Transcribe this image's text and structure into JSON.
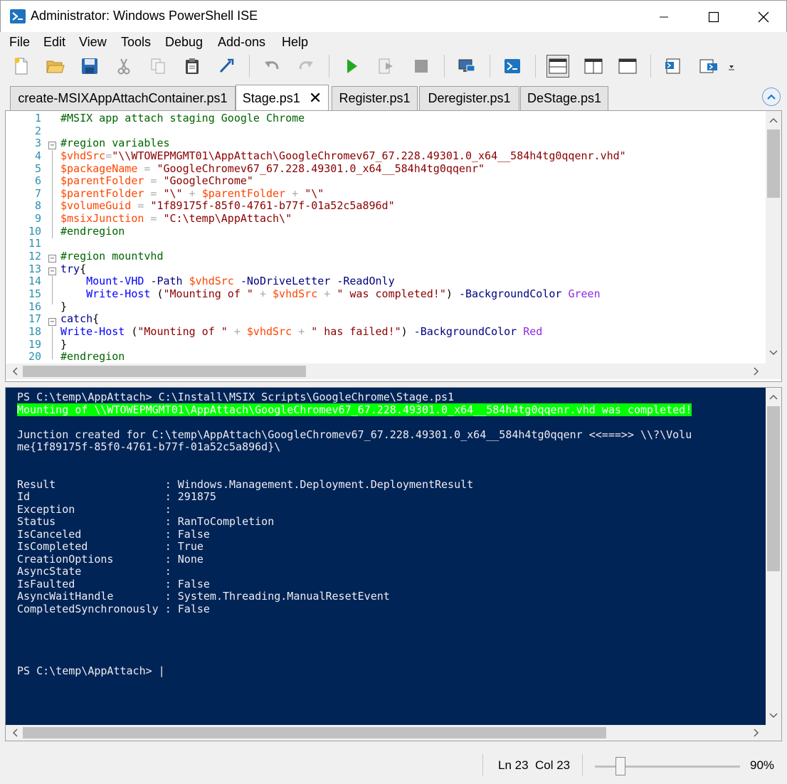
{
  "window": {
    "title": "Administrator: Windows PowerShell ISE",
    "min_glyph": "—",
    "max_glyph": "☐",
    "close_glyph": "✕"
  },
  "menu": [
    "File",
    "Edit",
    "View",
    "Tools",
    "Debug",
    "Add-ons",
    "Help"
  ],
  "toolbar": {
    "buttons": [
      "new-icon",
      "open-icon",
      "save-icon",
      "cut-icon",
      "copy-icon",
      "paste-icon",
      "clear-icon",
      "undo-icon",
      "redo-icon",
      "run-icon",
      "run-selection-icon",
      "stop-icon",
      "remote-icon",
      "powershell-icon",
      "layout-top-icon",
      "layout-right-icon",
      "layout-max-icon",
      "show-script-icon",
      "show-console-icon",
      "overflow-icon"
    ]
  },
  "tabs": [
    {
      "label": "create-MSIXAppAttachContainer.ps1",
      "active": false
    },
    {
      "label": "Stage.ps1",
      "active": true,
      "close": "✕"
    },
    {
      "label": "Register.ps1",
      "active": false
    },
    {
      "label": "Deregister.ps1",
      "active": false
    },
    {
      "label": "DeStage.ps1",
      "active": false
    }
  ],
  "editor": {
    "line_numbers": [
      "1",
      "2",
      "3",
      "4",
      "5",
      "6",
      "7",
      "8",
      "9",
      "10",
      "11",
      "12",
      "13",
      "14",
      "15",
      "16",
      "17",
      "18",
      "19",
      "20"
    ],
    "lines": [
      [
        {
          "t": "#MSIX app attach staging Google Chrome",
          "c": "comment"
        }
      ],
      [],
      [
        {
          "t": "#region variables",
          "c": "comment"
        }
      ],
      [
        {
          "t": "$vhdSrc",
          "c": "var"
        },
        {
          "t": "=",
          "c": "op"
        },
        {
          "t": "\"\\\\WTOWEPMGMT01\\AppAttach\\GoogleChromev67_67.228.49301.0_x64__584h4tg0qqenr.vhd\"",
          "c": "str"
        }
      ],
      [
        {
          "t": "$packageName",
          "c": "var"
        },
        {
          "t": " = ",
          "c": "op"
        },
        {
          "t": "\"GoogleChromev67_67.228.49301.0_x64__584h4tg0qqenr\"",
          "c": "str"
        }
      ],
      [
        {
          "t": "$parentFolder",
          "c": "var"
        },
        {
          "t": " = ",
          "c": "op"
        },
        {
          "t": "\"GoogleChrome\"",
          "c": "str"
        }
      ],
      [
        {
          "t": "$parentFolder",
          "c": "var"
        },
        {
          "t": " = ",
          "c": "op"
        },
        {
          "t": "\"\\\"",
          "c": "str"
        },
        {
          "t": " + ",
          "c": "op"
        },
        {
          "t": "$parentFolder",
          "c": "var"
        },
        {
          "t": " + ",
          "c": "op"
        },
        {
          "t": "\"\\\"",
          "c": "str"
        }
      ],
      [
        {
          "t": "$volumeGuid",
          "c": "var"
        },
        {
          "t": " = ",
          "c": "op"
        },
        {
          "t": "\"1f89175f-85f0-4761-b77f-01a52c5a896d\"",
          "c": "str"
        }
      ],
      [
        {
          "t": "$msixJunction",
          "c": "var"
        },
        {
          "t": " = ",
          "c": "op"
        },
        {
          "t": "\"C:\\temp\\AppAttach\\\"",
          "c": "str"
        }
      ],
      [
        {
          "t": "#endregion",
          "c": "comment"
        }
      ],
      [],
      [
        {
          "t": "#region mountvhd",
          "c": "comment"
        }
      ],
      [
        {
          "t": "try",
          "c": "kw"
        },
        {
          "t": "{",
          "c": "plain"
        }
      ],
      [
        {
          "t": "    ",
          "c": "plain"
        },
        {
          "t": "Mount-VHD",
          "c": "cmd"
        },
        {
          "t": " ",
          "c": "plain"
        },
        {
          "t": "-Path",
          "c": "param"
        },
        {
          "t": " ",
          "c": "plain"
        },
        {
          "t": "$vhdSrc",
          "c": "var"
        },
        {
          "t": " ",
          "c": "plain"
        },
        {
          "t": "-NoDriveLetter",
          "c": "param"
        },
        {
          "t": " ",
          "c": "plain"
        },
        {
          "t": "-ReadOnly",
          "c": "param"
        }
      ],
      [
        {
          "t": "    ",
          "c": "plain"
        },
        {
          "t": "Write-Host",
          "c": "cmd"
        },
        {
          "t": " (",
          "c": "plain"
        },
        {
          "t": "\"Mounting of \"",
          "c": "str"
        },
        {
          "t": " + ",
          "c": "op"
        },
        {
          "t": "$vhdSrc",
          "c": "var"
        },
        {
          "t": " + ",
          "c": "op"
        },
        {
          "t": "\" was completed!\"",
          "c": "str"
        },
        {
          "t": ") ",
          "c": "plain"
        },
        {
          "t": "-BackgroundColor",
          "c": "param"
        },
        {
          "t": " ",
          "c": "plain"
        },
        {
          "t": "Green",
          "c": "type"
        }
      ],
      [
        {
          "t": "}",
          "c": "plain"
        }
      ],
      [
        {
          "t": "catch",
          "c": "kw"
        },
        {
          "t": "{",
          "c": "plain"
        }
      ],
      [
        {
          "t": "Write-Host",
          "c": "cmd"
        },
        {
          "t": " (",
          "c": "plain"
        },
        {
          "t": "\"Mounting of \"",
          "c": "str"
        },
        {
          "t": " + ",
          "c": "op"
        },
        {
          "t": "$vhdSrc",
          "c": "var"
        },
        {
          "t": " + ",
          "c": "op"
        },
        {
          "t": "\" has failed!\"",
          "c": "str"
        },
        {
          "t": ") ",
          "c": "plain"
        },
        {
          "t": "-BackgroundColor",
          "c": "param"
        },
        {
          "t": " ",
          "c": "plain"
        },
        {
          "t": "Red",
          "c": "type"
        }
      ],
      [
        {
          "t": "}",
          "c": "plain"
        }
      ],
      [
        {
          "t": "#endregion",
          "c": "comment"
        }
      ]
    ]
  },
  "console": {
    "lines": [
      {
        "t": "PS C:\\temp\\AppAttach> C:\\Install\\MSIX Scripts\\GoogleChrome\\Stage.ps1"
      },
      {
        "t": "Mounting of \\\\WTOWEPMGMT01\\AppAttach\\GoogleChromev67_67.228.49301.0_x64__584h4tg0qqenr.vhd was completed!",
        "hl": true
      },
      {
        "t": ""
      },
      {
        "t": "Junction created for C:\\temp\\AppAttach\\GoogleChromev67_67.228.49301.0_x64__584h4tg0qqenr <<===>> \\\\?\\Volu"
      },
      {
        "t": "me{1f89175f-85f0-4761-b77f-01a52c5a896d}\\"
      },
      {
        "t": ""
      },
      {
        "t": ""
      },
      {
        "t": "Result                 : Windows.Management.Deployment.DeploymentResult"
      },
      {
        "t": "Id                     : 291875"
      },
      {
        "t": "Exception              :"
      },
      {
        "t": "Status                 : RanToCompletion"
      },
      {
        "t": "IsCanceled             : False"
      },
      {
        "t": "IsCompleted            : True"
      },
      {
        "t": "CreationOptions        : None"
      },
      {
        "t": "AsyncState             :"
      },
      {
        "t": "IsFaulted              : False"
      },
      {
        "t": "AsyncWaitHandle        : System.Threading.ManualResetEvent"
      },
      {
        "t": "CompletedSynchronously : False"
      },
      {
        "t": ""
      },
      {
        "t": ""
      },
      {
        "t": ""
      },
      {
        "t": ""
      },
      {
        "t": "PS C:\\temp\\AppAttach> |"
      }
    ]
  },
  "status": {
    "line": "Ln 23",
    "col": "Col 23",
    "zoom": "90%"
  },
  "colors": {
    "console_bg": "#012456",
    "highlight": "#00ff00",
    "accent": "#1e73be"
  }
}
